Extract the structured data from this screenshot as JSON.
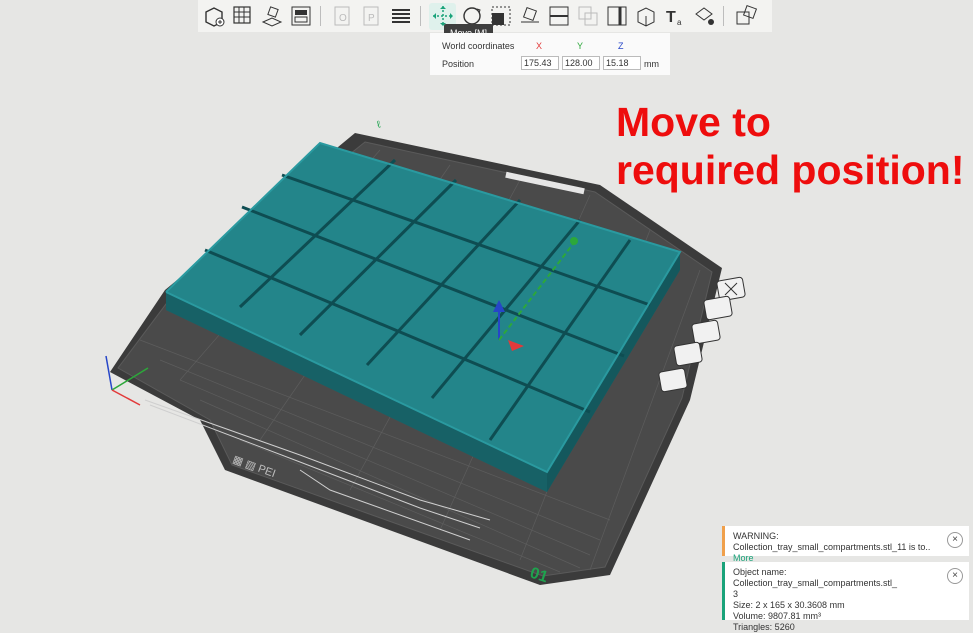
{
  "toolbar": {
    "tooltip": "Move [M]",
    "buttons": [
      "add-object",
      "arrange-grid",
      "orient",
      "plate-layout",
      "split-objects",
      "split-parts",
      "layers",
      "move",
      "rotate",
      "scale",
      "lay-on-face",
      "cut",
      "boolean",
      "support-paint",
      "seam-paint",
      "text-emboss",
      "color-paint",
      "assembly"
    ]
  },
  "move_panel": {
    "label_coords": "World coordinates",
    "axis_x": "X",
    "axis_y": "Y",
    "axis_z": "Z",
    "label_position": "Position",
    "x": "175.43",
    "y": "128.00",
    "z": "15.18",
    "unit": "mm",
    "colors": {
      "x": "#e23a3a",
      "y": "#2ca83a",
      "z": "#2646c8"
    }
  },
  "overlay": {
    "line1": "Move to",
    "line2": "required position!"
  },
  "bed": {
    "plate_number": "01"
  },
  "warning": {
    "title": "WARNING:",
    "text": "Collection_tray_small_compartments.stl_11 is to..",
    "link": "More"
  },
  "object_info": {
    "name": "Object name: Collection_tray_small_compartments.stl_",
    "name_cont": "3",
    "size": "Size: 2 x 165 x 30.3608 mm",
    "volume": "Volume: 9807.81 mm³",
    "triangles": "Triangles: 5260"
  },
  "colors": {
    "tray": "#1d7a7f",
    "bed": "#3d3d3d",
    "accent": "#1aa37a",
    "warning": "#f0a04b"
  }
}
